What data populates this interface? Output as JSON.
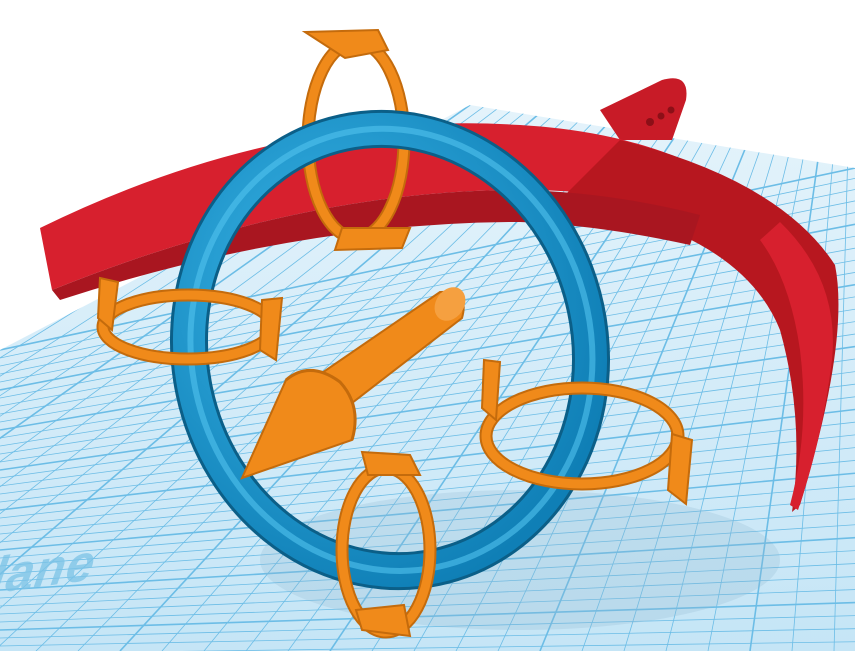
{
  "viewport": {
    "workplane_label": "lane",
    "colors": {
      "workplane": "#cfe9f8",
      "grid_line": "#66b9e4",
      "grid_major": "#3ea4da",
      "shape": "#d7202e",
      "shape_dark": "#a91620",
      "torus": "#1897cf",
      "torus_dark": "#0d6f9e",
      "gizmo": "#f08a1a",
      "gizmo_dark": "#c46b0c"
    },
    "gizmo": {
      "rotation_handles": [
        "rotate-top",
        "rotate-left",
        "rotate-right",
        "rotate-bottom"
      ],
      "arrow": "cone-arrow"
    }
  }
}
